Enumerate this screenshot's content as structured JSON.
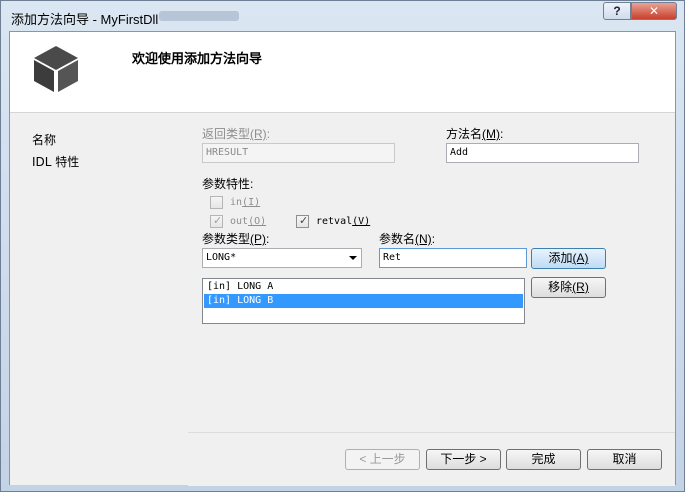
{
  "window": {
    "title": "添加方法向导 - MyFirstDll",
    "help_label": "?",
    "close_label": "✕"
  },
  "header": {
    "icon": "cube-icon",
    "title": "欢迎使用添加方法向导"
  },
  "nav": {
    "items": [
      {
        "label": "名称"
      },
      {
        "label": "IDL 特性"
      }
    ]
  },
  "form": {
    "return_type_label": "返回类型",
    "return_type_key": "(R)",
    "return_type_colon": ":",
    "return_type_value": "HRESULT",
    "method_name_label": "方法名",
    "method_name_key": "(M)",
    "method_name_colon": ":",
    "method_name_value": "Add",
    "param_attrs_label": "参数特性:",
    "in_label": "in",
    "in_key": "(I)",
    "in_checked": false,
    "out_label": "out",
    "out_key": "(O)",
    "out_checked": true,
    "retval_label": "retval",
    "retval_key": "(V)",
    "retval_checked": true,
    "param_type_label": "参数类型",
    "param_type_key": "(P)",
    "param_type_colon": ":",
    "param_type_value": "LONG*",
    "param_name_label": "参数名",
    "param_name_key": "(N)",
    "param_name_colon": ":",
    "param_name_value": "Ret",
    "add_button": "添加",
    "add_key": "(A)",
    "remove_button": "移除",
    "remove_key": "(R)",
    "params": [
      {
        "text": "[in] LONG A",
        "selected": false
      },
      {
        "text": "[in] LONG B",
        "selected": true
      }
    ]
  },
  "footer": {
    "prev": "< 上一步",
    "next": "下一步 >",
    "finish": "完成",
    "cancel": "取消"
  },
  "colors": {
    "selection": "#3399ff",
    "default_button": "#3c7fb1"
  }
}
